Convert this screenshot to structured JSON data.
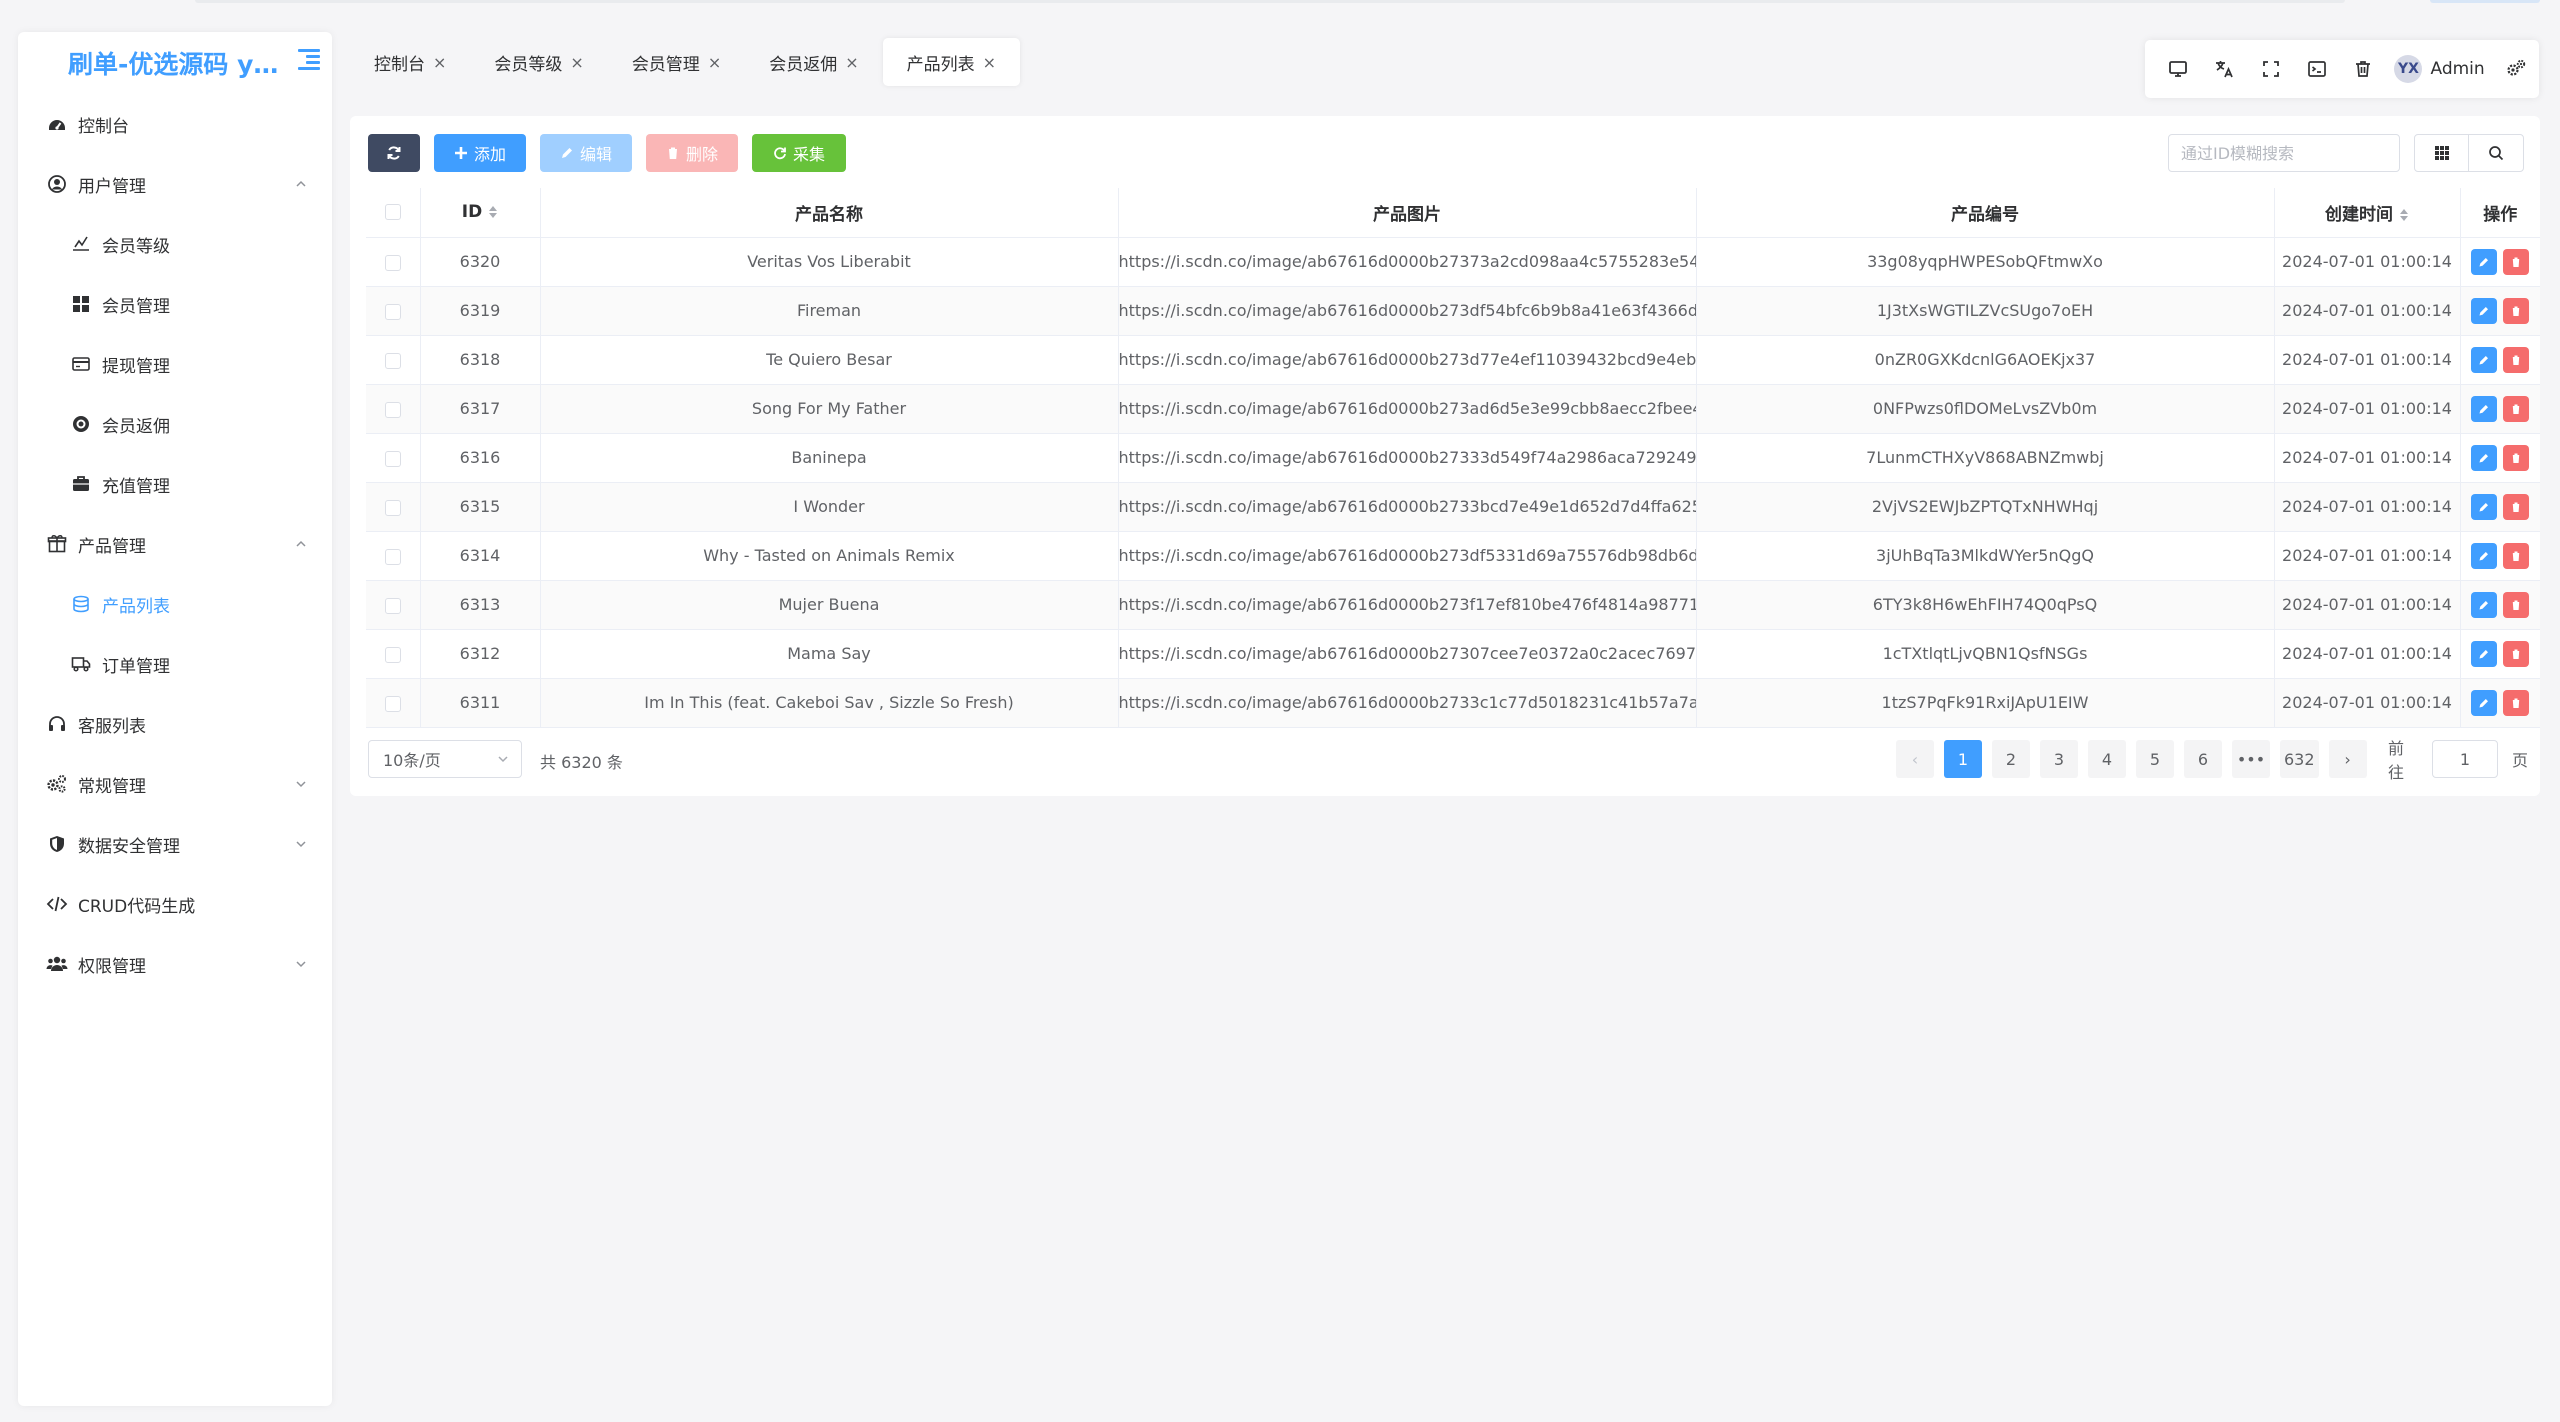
{
  "brand": {
    "title": "刷单-优选源码 yx..."
  },
  "colors": {
    "primary": "#409eff",
    "success": "#67c23a",
    "danger": "#f56c6c",
    "dark": "#3f4a62"
  },
  "sidebar": {
    "items": [
      {
        "label": "控制台",
        "icon": "dashboard-icon",
        "level": 1
      },
      {
        "label": "用户管理",
        "icon": "user-circle-icon",
        "level": 1,
        "expanded": true
      },
      {
        "label": "会员等级",
        "icon": "level-icon",
        "level": 2
      },
      {
        "label": "会员管理",
        "icon": "grid-icon",
        "level": 2
      },
      {
        "label": "提现管理",
        "icon": "card-icon",
        "level": 2
      },
      {
        "label": "会员返佣",
        "icon": "coin-icon",
        "level": 2
      },
      {
        "label": "充值管理",
        "icon": "briefcase-icon",
        "level": 2
      },
      {
        "label": "产品管理",
        "icon": "box-icon",
        "level": 1,
        "expanded": true
      },
      {
        "label": "产品列表",
        "icon": "database-icon",
        "level": 2,
        "active": true
      },
      {
        "label": "订单管理",
        "icon": "truck-icon",
        "level": 2
      },
      {
        "label": "客服列表",
        "icon": "headset-icon",
        "level": 1
      },
      {
        "label": "常规管理",
        "icon": "gears-icon",
        "level": 1,
        "expanded": false
      },
      {
        "label": "数据安全管理",
        "icon": "shield-icon",
        "level": 1,
        "expanded": false
      },
      {
        "label": "CRUD代码生成",
        "icon": "code-icon",
        "level": 1
      },
      {
        "label": "权限管理",
        "icon": "users-icon",
        "level": 1,
        "expanded": false
      }
    ]
  },
  "tabs": [
    {
      "label": "控制台",
      "active": false
    },
    {
      "label": "会员等级",
      "active": false
    },
    {
      "label": "会员管理",
      "active": false
    },
    {
      "label": "会员返佣",
      "active": false
    },
    {
      "label": "产品列表",
      "active": true
    }
  ],
  "navbar": {
    "user": "Admin",
    "avatar_text": "YX"
  },
  "toolbar": {
    "add": "添加",
    "edit": "编辑",
    "delete": "删除",
    "collect": "采集",
    "search_placeholder": "通过ID模糊搜索"
  },
  "table": {
    "columns": [
      "ID",
      "产品名称",
      "产品图片",
      "产品编号",
      "创建时间",
      "操作"
    ],
    "rows": [
      {
        "id": "6320",
        "name": "Veritas Vos Liberabit",
        "image": "https://i.scdn.co/image/ab67616d0000b27373a2cd098aa4c5755283e54b",
        "code": "33g08yqpHWPESobQFtmwXo",
        "created": "2024-07-01 01:00:14"
      },
      {
        "id": "6319",
        "name": "Fireman",
        "image": "https://i.scdn.co/image/ab67616d0000b273df54bfc6b9b8a41e63f4366d",
        "code": "1J3tXsWGTILZVcSUgo7oEH",
        "created": "2024-07-01 01:00:14"
      },
      {
        "id": "6318",
        "name": "Te Quiero Besar",
        "image": "https://i.scdn.co/image/ab67616d0000b273d77e4ef11039432bcd9e4eb7",
        "code": "0nZR0GXKdcnlG6AOEKjx37",
        "created": "2024-07-01 01:00:14"
      },
      {
        "id": "6317",
        "name": "Song For My Father",
        "image": "https://i.scdn.co/image/ab67616d0000b273ad6d5e3e99cbb8aecc2fbee4",
        "code": "0NFPwzs0flDOMeLvsZVb0m",
        "created": "2024-07-01 01:00:14"
      },
      {
        "id": "6316",
        "name": "Baninepa",
        "image": "https://i.scdn.co/image/ab67616d0000b27333d549f74a2986aca7292498",
        "code": "7LunmCTHXyV868ABNZmwbj",
        "created": "2024-07-01 01:00:14"
      },
      {
        "id": "6315",
        "name": "I Wonder",
        "image": "https://i.scdn.co/image/ab67616d0000b2733bcd7e49e1d652d7d4ffa625",
        "code": "2VjVS2EWJbZPTQTxNHWHqj",
        "created": "2024-07-01 01:00:14"
      },
      {
        "id": "6314",
        "name": "Why - Tasted on Animals Remix",
        "image": "https://i.scdn.co/image/ab67616d0000b273df5331d69a75576db98db6d4",
        "code": "3jUhBqTa3MlkdWYer5nQgQ",
        "created": "2024-07-01 01:00:14"
      },
      {
        "id": "6313",
        "name": "Mujer Buena",
        "image": "https://i.scdn.co/image/ab67616d0000b273f17ef810be476f4814a98771",
        "code": "6TY3k8H6wEhFIH74Q0qPsQ",
        "created": "2024-07-01 01:00:14"
      },
      {
        "id": "6312",
        "name": "Mama Say",
        "image": "https://i.scdn.co/image/ab67616d0000b27307cee7e0372a0c2acec7697d",
        "code": "1cTXtlqtLjvQBN1QsfNSGs",
        "created": "2024-07-01 01:00:14"
      },
      {
        "id": "6311",
        "name": "Im In This (feat. Cakeboi Sav , Sizzle So Fresh)",
        "image": "https://i.scdn.co/image/ab67616d0000b2733c1c77d5018231c41b57a7af",
        "code": "1tzS7PqFk91RxiJApU1EIW",
        "created": "2024-07-01 01:00:14"
      }
    ]
  },
  "pagination": {
    "page_size": "10条/页",
    "total": "共 6320 条",
    "pages": [
      "1",
      "2",
      "3",
      "4",
      "5",
      "6",
      "•••",
      "632"
    ],
    "current": "1",
    "prev": "‹",
    "next": "›",
    "goto_prefix": "前往",
    "goto_value": "1",
    "goto_suffix": "页"
  }
}
